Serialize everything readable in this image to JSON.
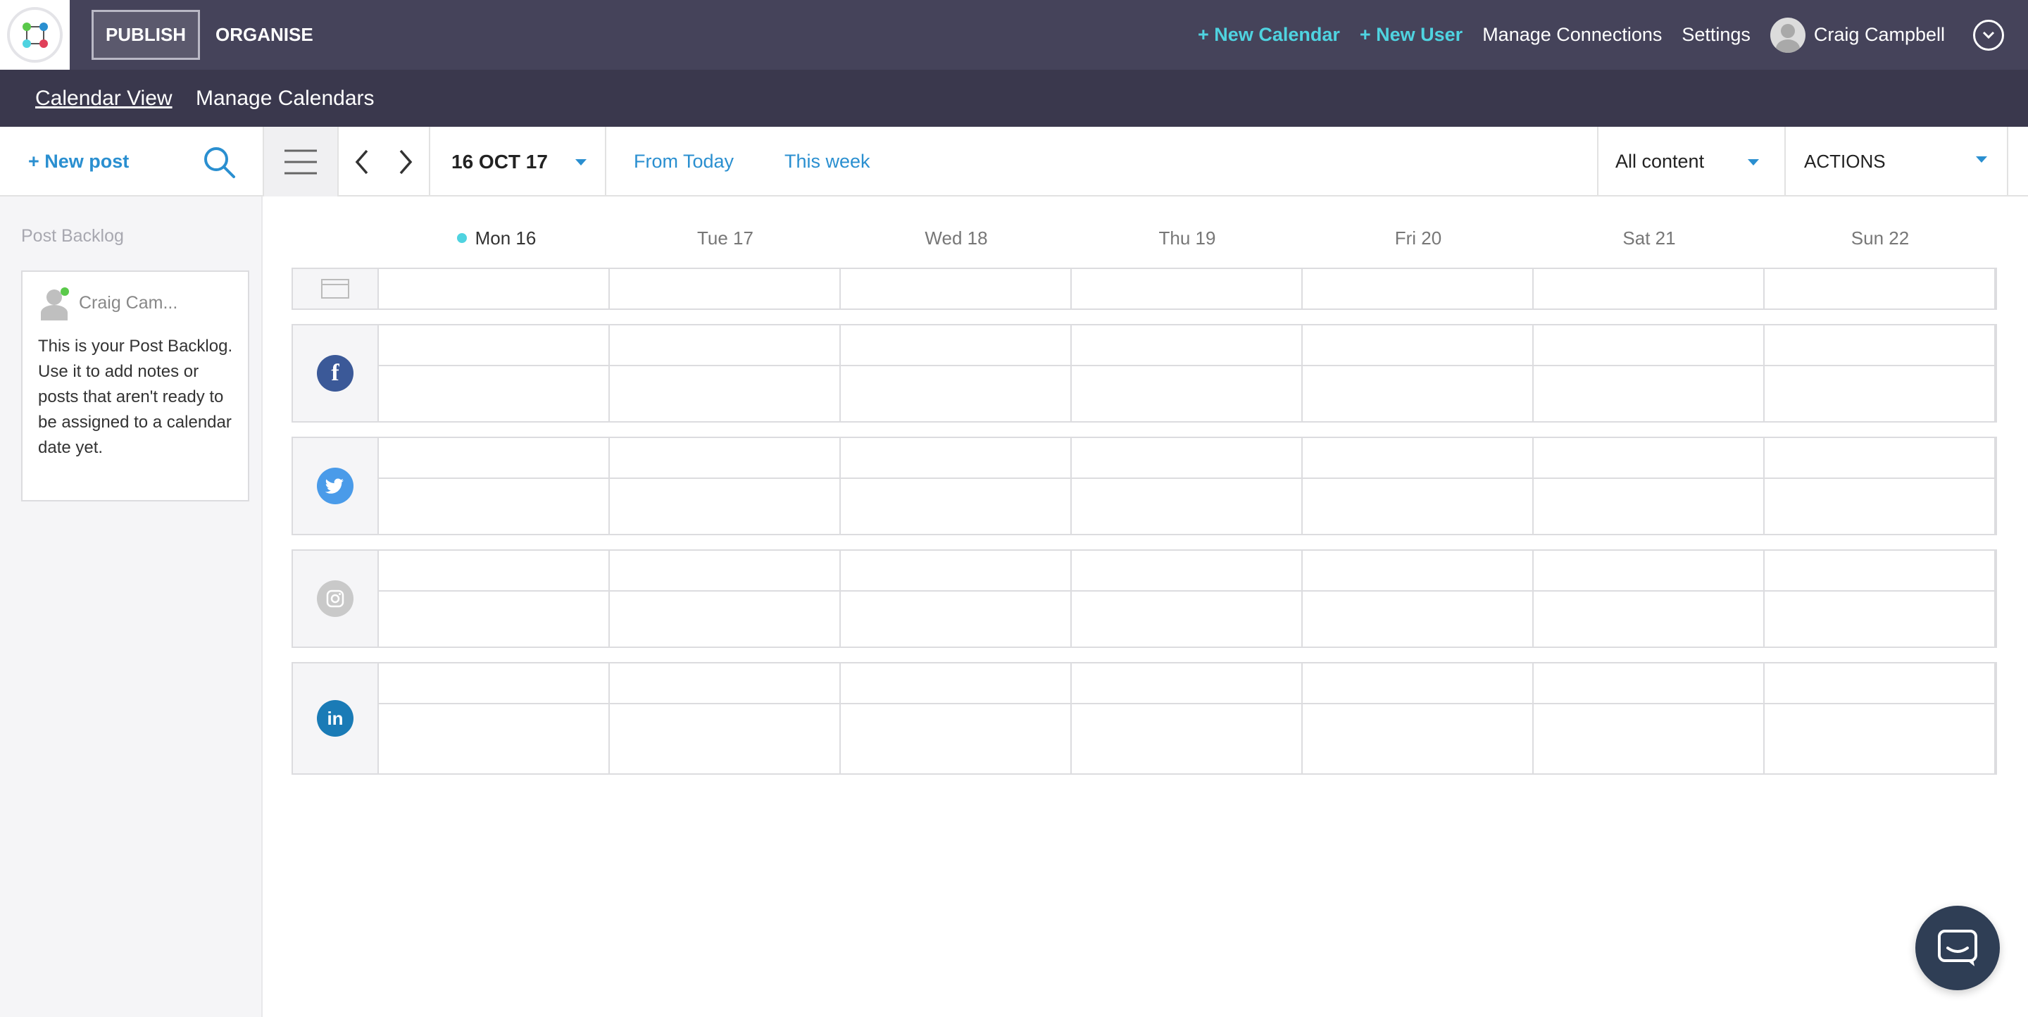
{
  "topbar": {
    "publish_label": "PUBLISH",
    "organise_label": "ORGANISE",
    "new_calendar": "+ New Calendar",
    "new_user": "+ New User",
    "manage_connections": "Manage Connections",
    "settings": "Settings",
    "user_name": "Craig Campbell"
  },
  "subnav": {
    "calendar_view": "Calendar View",
    "manage_calendars": "Manage Calendars"
  },
  "toolbar": {
    "new_post": "+ New post",
    "date": "16 OCT 17",
    "from_today": "From Today",
    "this_week": "This week",
    "content_filter": "All content",
    "actions": "ACTIONS"
  },
  "sidebar": {
    "title": "Post Backlog",
    "card_author": "Craig Cam...",
    "card_text": "This is your Post Backlog. Use it to add notes or posts that aren't ready to be assigned to a calendar date yet."
  },
  "calendar": {
    "days": [
      "Mon 16",
      "Tue 17",
      "Wed 18",
      "Thu 19",
      "Fri 20",
      "Sat 21",
      "Sun 22"
    ],
    "today_index": 0,
    "networks": [
      "general",
      "facebook",
      "twitter",
      "instagram",
      "linkedin"
    ]
  },
  "colors": {
    "topbar": "#45435a",
    "subbar": "#3a384d",
    "accent": "#4fd3e0",
    "link": "#2a8fd0",
    "facebook": "#3b5998",
    "twitter": "#4a9be9",
    "instagram": "#c9c9c9",
    "linkedin": "#1a7bb6"
  }
}
